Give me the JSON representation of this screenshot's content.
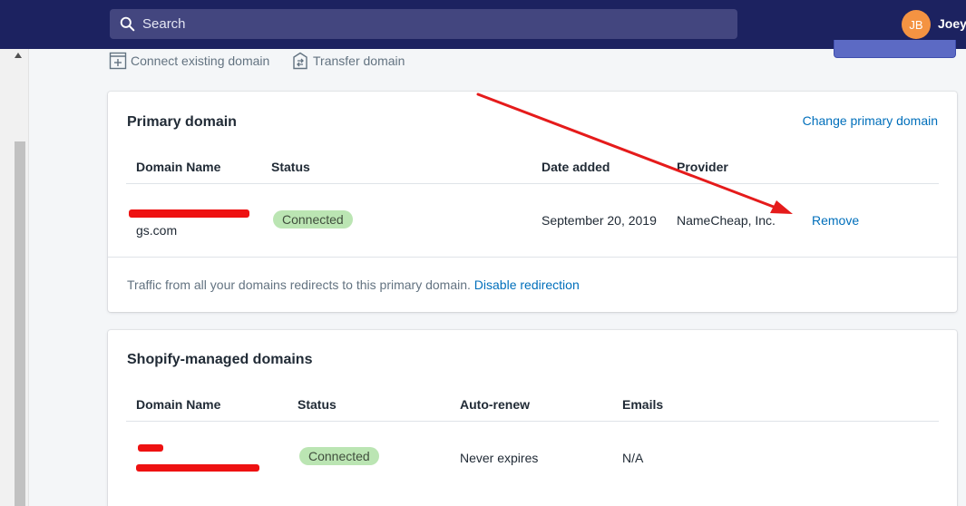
{
  "header": {
    "search_placeholder": "Search",
    "avatar_initials": "JB",
    "user_name": "Joey"
  },
  "actions": {
    "connect_existing": "Connect existing domain",
    "transfer": "Transfer domain"
  },
  "primary": {
    "title": "Primary domain",
    "change_link": "Change primary domain",
    "columns": [
      "Domain Name",
      "Status",
      "Date added",
      "Provider"
    ],
    "row": {
      "domain_suffix": "gs.com",
      "status": "Connected",
      "date_added": "September 20, 2019",
      "provider": "NameCheap, Inc.",
      "remove": "Remove"
    },
    "redirect_text": "Traffic from all your domains redirects to this primary domain.",
    "redirect_link": "Disable redirection"
  },
  "managed": {
    "title": "Shopify-managed domains",
    "columns": [
      "Domain Name",
      "Status",
      "Auto-renew",
      "Emails"
    ],
    "row": {
      "status": "Connected",
      "auto_renew": "Never expires",
      "emails": "N/A"
    }
  },
  "colors": {
    "topbar": "#1c2260",
    "link": "#006fbb",
    "badge_success": "#bbe5b3",
    "annotation_arrow": "#e51b1b",
    "redaction": "#ee1111"
  }
}
